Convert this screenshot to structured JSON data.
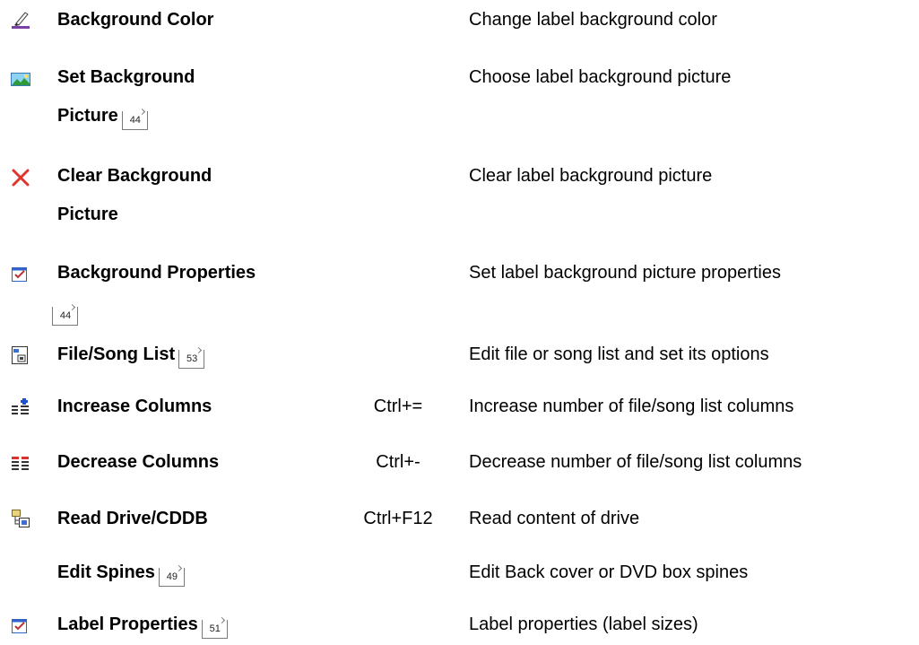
{
  "commands": [
    {
      "icon": "paint-brush-icon",
      "name": "Background Color",
      "shortcut": "",
      "description": "Change label background color"
    },
    {
      "icon": "landscape-picture-icon",
      "name": "Set Background Picture",
      "ref": "44",
      "shortcut": "",
      "description": "Choose label background picture"
    },
    {
      "icon": "red-x-icon",
      "name": "Clear Background Picture",
      "shortcut": "",
      "description": "Clear label background picture"
    },
    {
      "icon": "properties-checkbox-icon",
      "name": "Background Properties",
      "ref": "44",
      "shortcut": "",
      "description": "Set label background picture properties"
    },
    {
      "icon": "file-list-icon",
      "name": "File/Song List",
      "ref": "53",
      "shortcut": "",
      "description": "Edit file or song list and set its options"
    },
    {
      "icon": "increase-columns-icon",
      "name": "Increase Columns",
      "shortcut": "Ctrl+=",
      "description": "Increase number of file/song list columns"
    },
    {
      "icon": "decrease-columns-icon",
      "name": "Decrease Columns",
      "shortcut": "Ctrl+-",
      "description": "Decrease number of file/song list columns"
    },
    {
      "icon": "read-drive-icon",
      "name": "Read Drive/CDDB",
      "shortcut": "Ctrl+F12",
      "description": "Read content of drive"
    },
    {
      "icon": "",
      "name": "Edit Spines",
      "ref": "49",
      "shortcut": "",
      "description": "Edit Back cover or DVD box spines"
    },
    {
      "icon": "properties-checkbox-icon",
      "name": "Label Properties",
      "ref": "51",
      "shortcut": "",
      "description": "Label properties (label sizes)"
    }
  ],
  "colors": {
    "text": "#000000",
    "background": "#ffffff",
    "brush": "#7b3fa6",
    "x_icon": "#e0352b",
    "icon_blue": "#2f63c9"
  }
}
